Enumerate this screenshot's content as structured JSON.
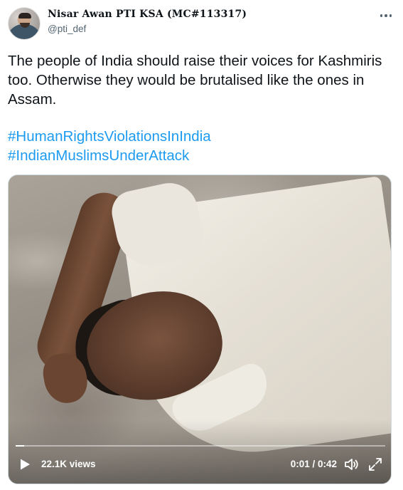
{
  "author": {
    "display_name": "Nisar Awan PTI KSA (MC#113317)",
    "handle": "@pti_def",
    "avatar_icon": "profile-photo"
  },
  "more_icon": "ellipsis-icon",
  "tweet": {
    "text": "The people of India should raise their voices for Kashmiris too. Otherwise they would be brutalised like the ones in Assam.",
    "hashtags": [
      "#HumanRightsViolationsInIndia",
      "#IndianMuslimsUnderAttack"
    ]
  },
  "video": {
    "views": "22.1K views",
    "time_display": "0:01 / 0:42",
    "progress_fraction": 0.024,
    "controls": [
      "play-icon",
      "volume-icon",
      "fullscreen-icon"
    ]
  },
  "colors": {
    "link": "#1d9bf0",
    "text": "#0f1419",
    "secondary": "#536471"
  }
}
